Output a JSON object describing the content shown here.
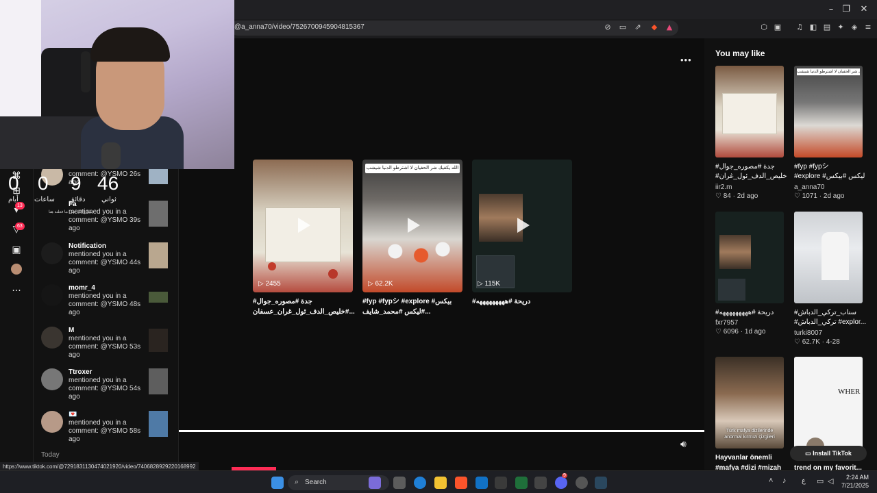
{
  "browser": {
    "url": "@a_anna70/video/7526700945904815367",
    "status_url": "https://www.tiktok.com/@7291831130474021920/video/7406828929220168992"
  },
  "countdown": {
    "days_value": "0",
    "days_label": "أيام",
    "hours_value": "0",
    "hours_label": "ساعات",
    "minutes_value": "9",
    "minutes_label": "دقائق",
    "seconds_value": "46",
    "seconds_label": "ثواني"
  },
  "nav": {
    "inbox_badge": "13",
    "activity_badge": "63"
  },
  "notifications": [
    {
      "name": "",
      "text": "mentioned you in a comment: @YSMO 26s ago"
    },
    {
      "name": "Fa",
      "text": "mentioned you in a comment: @YSMO 39s ago"
    },
    {
      "name": "Notification",
      "text": "mentioned you in a comment: @YSMO 44s ago"
    },
    {
      "name": "momr_4",
      "text": "mentioned you in a comment: @YSMO 48s ago"
    },
    {
      "name": "M",
      "text": "mentioned you in a comment: @YSMO 53s ago"
    },
    {
      "name": "Ttroxer",
      "text": "mentioned you in a comment: @YSMO 54s ago"
    },
    {
      "name": "💌",
      "text": "mentioned you in a comment: @YSMO 58s ago"
    }
  ],
  "notif_sub_caption": "شكرا لك على ما فعلته هنا",
  "today_label": "Today",
  "main": {
    "more_label": "•••",
    "videos": [
      {
        "views": "2455",
        "caption": "#جدة #مصوره_جوال #خليص_الدف_ئول_غران_عسفان..."
      },
      {
        "views": "62.2K",
        "caption": "#fyp #fypシ #explore #بيكس #ليكس #محمد_شايف..."
      },
      {
        "views": "115K",
        "caption": "#دريحة #هههههههههه"
      }
    ],
    "video2_overlay": "الله يكفيك شر الحفيان لا اشترطو الدنيا شيشب"
  },
  "rail": {
    "heading": "You may like",
    "items": [
      {
        "caption1": "#جدة #مصوره_جوال",
        "caption2": "#خليص_الدف_ئول_غران...",
        "user": "iir2.m",
        "likes": "84",
        "age": "2d ago"
      },
      {
        "caption1": "#fyp #fypシ",
        "caption2": "#explore #ليكس #بيكس",
        "user": "a_anna70",
        "likes": "1071",
        "age": "2d ago"
      },
      {
        "caption1": "#دريحة #هههههههههه",
        "caption2": "",
        "user": "fxr7957",
        "likes": "6096",
        "age": "1d ago"
      },
      {
        "caption1": "#سناب_تركي_الدباش",
        "caption2": "#تركي_الدباش #explor...",
        "user": "turki8007",
        "likes": "62.7K",
        "age": "4-28"
      },
      {
        "caption1": "Hayvanlar önemli",
        "caption2": "#mafya #dizi #mizah",
        "user": "",
        "likes": "",
        "age": ""
      },
      {
        "caption1": "trend on my favorit...",
        "caption2": "",
        "user": "",
        "likes": "",
        "age": ""
      }
    ],
    "turkish_overlay": "Türk mafya dizilerinde anormal kırmızı çizgileri",
    "where_text": "WHER",
    "install_label": "Install TikTok"
  },
  "taskbar": {
    "search_label": "Search",
    "time": "2:24 AM",
    "date": "7/21/2025",
    "lang": "ع",
    "discord_badge": "9"
  }
}
